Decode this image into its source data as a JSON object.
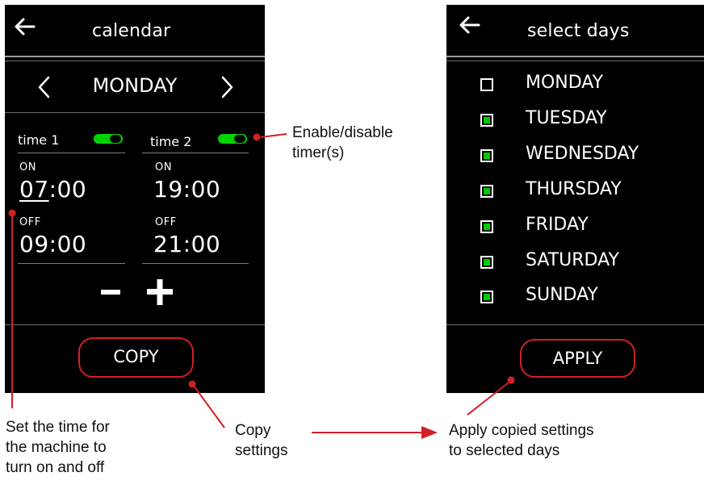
{
  "calendar_screen": {
    "back_icon": "arrow-left-icon",
    "title": "calendar",
    "day": "MONDAY",
    "prev_icon": "chevron-left-icon",
    "next_icon": "chevron-right-icon",
    "timer1": {
      "label": "time 1",
      "enabled": true,
      "on_label": "ON",
      "on_hour": "07",
      "on_minute": "00",
      "off_label": "OFF",
      "off_hour": "09",
      "off_minute": "00"
    },
    "timer2": {
      "label": "time 2",
      "enabled": true,
      "on_label": "ON",
      "on_hour": "19",
      "on_minute": "00",
      "off_label": "OFF",
      "off_hour": "21",
      "off_minute": "00"
    },
    "separator": ":",
    "minus_icon": "minus-icon",
    "plus_icon": "plus-icon",
    "copy_label": "COPY"
  },
  "days_screen": {
    "back_icon": "arrow-left-icon",
    "title": "select days",
    "days": [
      {
        "name": "MONDAY",
        "checked": false
      },
      {
        "name": "TUESDAY",
        "checked": true
      },
      {
        "name": "WEDNESDAY",
        "checked": true
      },
      {
        "name": "THURSDAY",
        "checked": true
      },
      {
        "name": "FRIDAY",
        "checked": true
      },
      {
        "name": "SATURDAY",
        "checked": true
      },
      {
        "name": "SUNDAY",
        "checked": true
      }
    ],
    "apply_label": "APPLY"
  },
  "annotations": {
    "enable_line1": "Enable/disable",
    "enable_line2": "timer(s)",
    "set_time_line1": "Set the time for",
    "set_time_line2": "the machine to",
    "set_time_line3": "turn on and off",
    "copy_line1": "Copy",
    "copy_line2": "settings",
    "apply_line1": "Apply copied settings",
    "apply_line2": "to selected days"
  },
  "colors": {
    "accent_red": "#d11f26",
    "toggle_green": "#00d400",
    "screen_bg": "#000000"
  }
}
